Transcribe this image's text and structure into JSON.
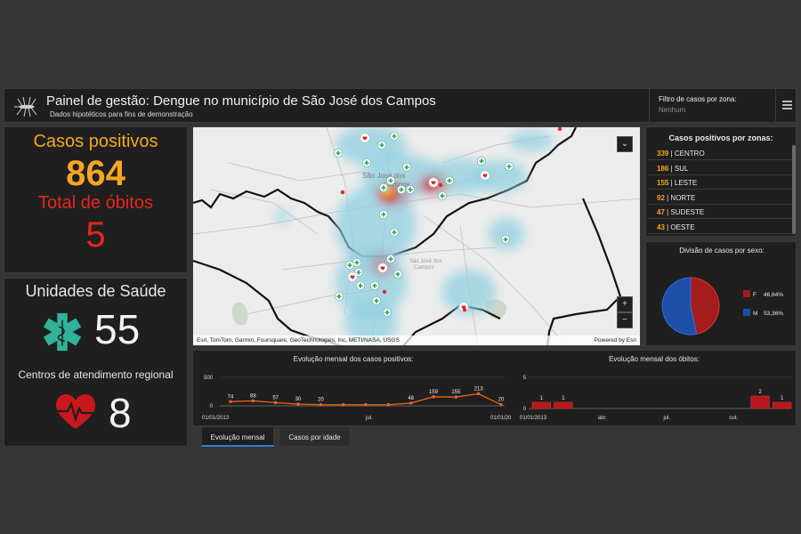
{
  "header": {
    "title": "Painel de gestão: Dengue no município de São José dos Campos",
    "subtitle": "Dados hipotéticos para fins de demonstração",
    "filter_label": "Filtro de casos por zona:",
    "filter_value": "Nenhum"
  },
  "kpis": {
    "cases_label": "Casos positivos",
    "cases_value": "864",
    "deaths_label": "Total de óbitos",
    "deaths_value": "5"
  },
  "units": {
    "health_label": "Unidades de Saúde",
    "health_value": "55",
    "regional_label": "Centros de atendimento regional",
    "regional_value": "8"
  },
  "map": {
    "attribution": "Esri, TomTom, Garmin, Foursquare, GeoTechnologies, Inc, METI/NASA, USGS",
    "powered": "Powered by Esri",
    "zoom_in": "+",
    "zoom_out": "−"
  },
  "zones": {
    "title": "Casos positivos por zonas:",
    "items": [
      {
        "value": "339",
        "name": "| CENTRO"
      },
      {
        "value": "186",
        "name": "| SUL"
      },
      {
        "value": "155",
        "name": "| LESTE"
      },
      {
        "value": "92",
        "name": "| NORTE"
      },
      {
        "value": "47",
        "name": "| SUDESTE"
      },
      {
        "value": "43",
        "name": "| OESTE"
      }
    ]
  },
  "colors": {
    "accent_orange": "#f6a623",
    "death_red": "#e8251f",
    "health_teal": "#2fb39b",
    "female": "#a51c1c",
    "male": "#1f4ea8",
    "line": "#e8631c",
    "bar": "#b5191c"
  },
  "tabs": [
    "Evolução mensal",
    "Casos por idade"
  ],
  "chart_data": [
    {
      "type": "pie",
      "title": "Divisão de casos por sexo:",
      "categories": [
        "F",
        "M"
      ],
      "values": [
        46.64,
        53.36
      ],
      "labels": [
        "46,64%",
        "53,36%"
      ]
    },
    {
      "type": "line",
      "title": "Evolução mensal dos casos positivos:",
      "ylim": [
        0,
        500
      ],
      "yticks": [
        "500",
        "0"
      ],
      "xticks": [
        "01/01/2013",
        "jul.",
        "01/01/20"
      ],
      "x": [
        "2013-01",
        "2013-02",
        "2013-03",
        "2013-04",
        "2013-05",
        "2013-06",
        "2013-07",
        "2013-08",
        "2013-09",
        "2013-10",
        "2013-11",
        "2013-12",
        "2014-01"
      ],
      "values": [
        74,
        88,
        57,
        30,
        20,
        20,
        20,
        20,
        48,
        159,
        155,
        213,
        20
      ],
      "point_labels": [
        "74",
        "88",
        "57",
        "30",
        "20",
        null,
        null,
        null,
        "48",
        "159",
        "155",
        "213",
        "20"
      ]
    },
    {
      "type": "bar",
      "title": "Evolução mensal dos óbitos:",
      "ylim": [
        0,
        5
      ],
      "yticks": [
        "5",
        "0"
      ],
      "xticks": [
        "01/01/2013",
        "abr.",
        "jul.",
        "out."
      ],
      "x": [
        "2013-01",
        "2013-02",
        "2013-03",
        "2013-04",
        "2013-05",
        "2013-06",
        "2013-07",
        "2013-08",
        "2013-09",
        "2013-10",
        "2013-11",
        "2013-12"
      ],
      "values": [
        1,
        1,
        0,
        0,
        0,
        0,
        0,
        0,
        0,
        0,
        2,
        1
      ]
    }
  ]
}
